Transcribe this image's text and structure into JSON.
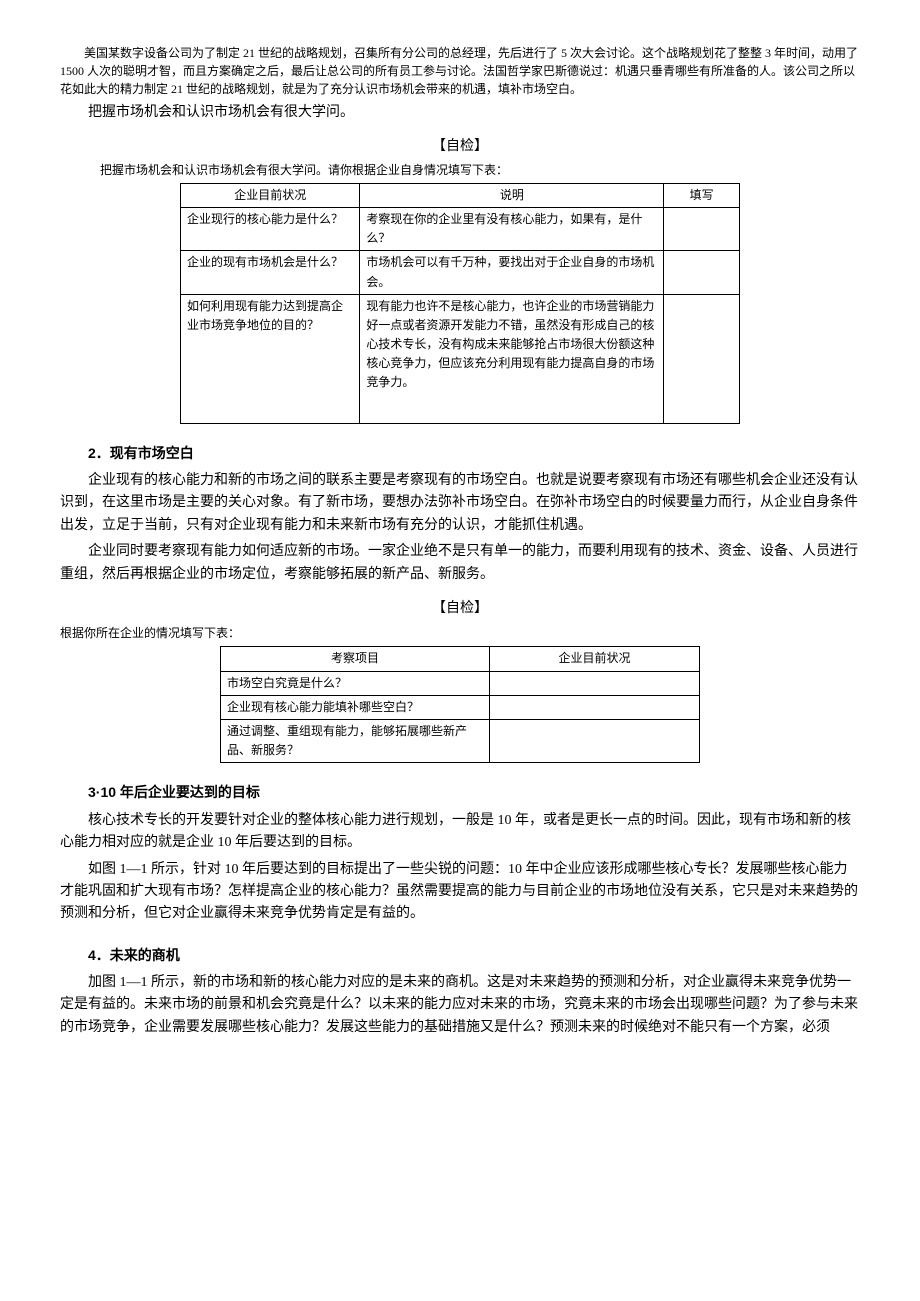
{
  "intro": {
    "case": "美国某数字设备公司为了制定 21 世纪的战略规划，召集所有分公司的总经理，先后进行了 5 次大会讨论。这个战略规划花了整整 3 年时间，动用了 1500 人次的聪明才智，而且方案确定之后，最后让总公司的所有员工参与讨论。法国哲学家巴斯德说过：机遇只垂青哪些有所准备的人。该公司之所以花如此大的精力制定 21 世纪的战略规划，就是为了充分认识市场机会带来的机遇，填补市场空白。",
    "lead": "把握市场机会和认识市场机会有很大学问。"
  },
  "check1": {
    "title": "【自检】",
    "caption": "把握市场机会和认识市场机会有很大学问。请你根据企业自身情况填写下表：",
    "headers": {
      "c1": "企业目前状况",
      "c2": "说明",
      "c3": "填写"
    },
    "rows": [
      {
        "c1": "企业现行的核心能力是什么？",
        "c2": "考察现在你的企业里有没有核心能力，如果有，是什么？",
        "c3": ""
      },
      {
        "c1": "企业的现有市场机会是什么？",
        "c2": "市场机会可以有千万种，要找出对于企业自身的市场机会。",
        "c3": ""
      },
      {
        "c1": "如何利用现有能力达到提高企业市场竞争地位的目的？",
        "c2": "现有能力也许不是核心能力，也许企业的市场营销能力好一点或者资源开发能力不错，虽然没有形成自己的核心技术专长，没有构成未来能够抢占市场很大份额这种核心竞争力，但应该充分利用现有能力提高自身的市场竞争力。",
        "c3": ""
      }
    ]
  },
  "sec2": {
    "title": "2．现有市场空白",
    "p1": "企业现有的核心能力和新的市场之间的联系主要是考察现有的市场空白。也就是说要考察现有市场还有哪些机会企业还没有认识到，在这里市场是主要的关心对象。有了新市场，要想办法弥补市场空白。在弥补市场空白的时候要量力而行，从企业自身条件出发，立足于当前，只有对企业现有能力和未来新市场有充分的认识，才能抓住机遇。",
    "p2": "企业同时要考察现有能力如何适应新的市场。一家企业绝不是只有单一的能力，而要利用现有的技术、资金、设备、人员进行重组，然后再根据企业的市场定位，考察能够拓展的新产品、新服务。"
  },
  "check2": {
    "title": "【自检】",
    "caption": "根据你所在企业的情况填写下表：",
    "headers": {
      "c1": "考察项目",
      "c2": "企业目前状况"
    },
    "rows": [
      {
        "c1": "市场空白究竟是什么？",
        "c2": ""
      },
      {
        "c1": "企业现有核心能力能填补哪些空白？",
        "c2": ""
      },
      {
        "c1": "通过调整、重组现有能力，能够拓展哪些新产品、新服务？",
        "c2": ""
      }
    ]
  },
  "sec3": {
    "title": "3·10 年后企业要达到的目标",
    "p1": "核心技术专长的开发要针对企业的整体核心能力进行规划，一般是 10 年，或者是更长一点的时间。因此，现有市场和新的核心能力相对应的就是企业 10 年后要达到的目标。",
    "p2": "如图 1—1 所示，针对 10 年后要达到的目标提出了一些尖锐的问题：10 年中企业应该形成哪些核心专长？发展哪些核心能力才能巩固和扩大现有市场？怎样提高企业的核心能力？虽然需要提高的能力与目前企业的市场地位没有关系，它只是对未来趋势的预测和分析，但它对企业赢得未来竞争优势肯定是有益的。"
  },
  "sec4": {
    "title": "4．未来的商机",
    "p1": "加图 1—1 所示，新的市场和新的核心能力对应的是未来的商机。这是对未来趋势的预测和分析，对企业赢得未来竞争优势一定是有益的。未来市场的前景和机会究竟是什么？以未来的能力应对未来的市场，究竟未来的市场会出现哪些问题？为了参与未来的市场竞争，企业需要发展哪些核心能力？发展这些能力的基础措施又是什么？预测未来的时候绝对不能只有一个方案，必须"
  }
}
